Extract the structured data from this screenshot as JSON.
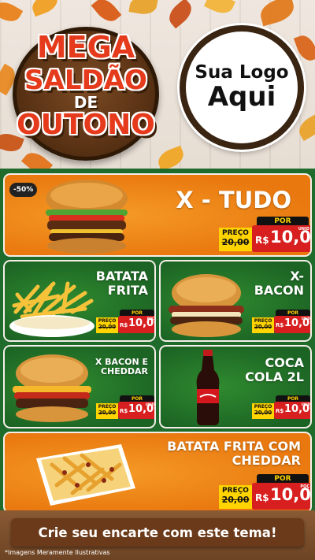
{
  "header": {
    "badge_lines": [
      "MEGA",
      "SALDÃO",
      "DE",
      "OUTONO"
    ],
    "logo_line1": "Sua Logo",
    "logo_line2": "Aqui"
  },
  "colors": {
    "orange": "#e9780f",
    "green": "#1c6424",
    "price_red": "#d81f1f",
    "price_yellow": "#ffd400"
  },
  "products": [
    {
      "title_lines": [
        "X - TUDO"
      ],
      "discount": "-50%",
      "por": "POR",
      "preco_label": "PREÇO",
      "old_price": "20,00",
      "currency": "R$",
      "new_price": "10,00",
      "unit": "UNID",
      "icon": "burger-icon"
    },
    {
      "title_lines": [
        "BATATA",
        "FRITA"
      ],
      "por": "POR",
      "preco_label": "PREÇO",
      "old_price": "20,00",
      "currency": "R$",
      "new_price": "10,00",
      "unit": "POÇ",
      "icon": "fries-icon"
    },
    {
      "title_lines": [
        "X-",
        "BACON"
      ],
      "por": "POR",
      "preco_label": "PREÇO",
      "old_price": "20,00",
      "currency": "R$",
      "new_price": "10,00",
      "unit": "UNID",
      "icon": "burger-icon"
    },
    {
      "title_lines": [
        "X BACON E",
        "CHEDDAR"
      ],
      "por": "POR",
      "preco_label": "PREÇO",
      "old_price": "20,00",
      "currency": "R$",
      "new_price": "10,00",
      "unit": "UNID",
      "icon": "burger-icon"
    },
    {
      "title_lines": [
        "COCA",
        "COLA 2L"
      ],
      "por": "POR",
      "preco_label": "PREÇO",
      "old_price": "20,00",
      "currency": "R$",
      "new_price": "10,00",
      "unit": "UNID",
      "icon": "soda-bottle-icon"
    },
    {
      "title_lines": [
        "BATATA FRITA COM",
        "CHEDDAR"
      ],
      "por": "POR",
      "preco_label": "PREÇO",
      "old_price": "20,00",
      "currency": "R$",
      "new_price": "10,00",
      "unit": "POÇ",
      "icon": "cheese-fries-icon"
    }
  ],
  "footer": {
    "cta": "Crie seu encarte com este tema!",
    "note": "*Imagens Meramente Ilustrativas"
  }
}
